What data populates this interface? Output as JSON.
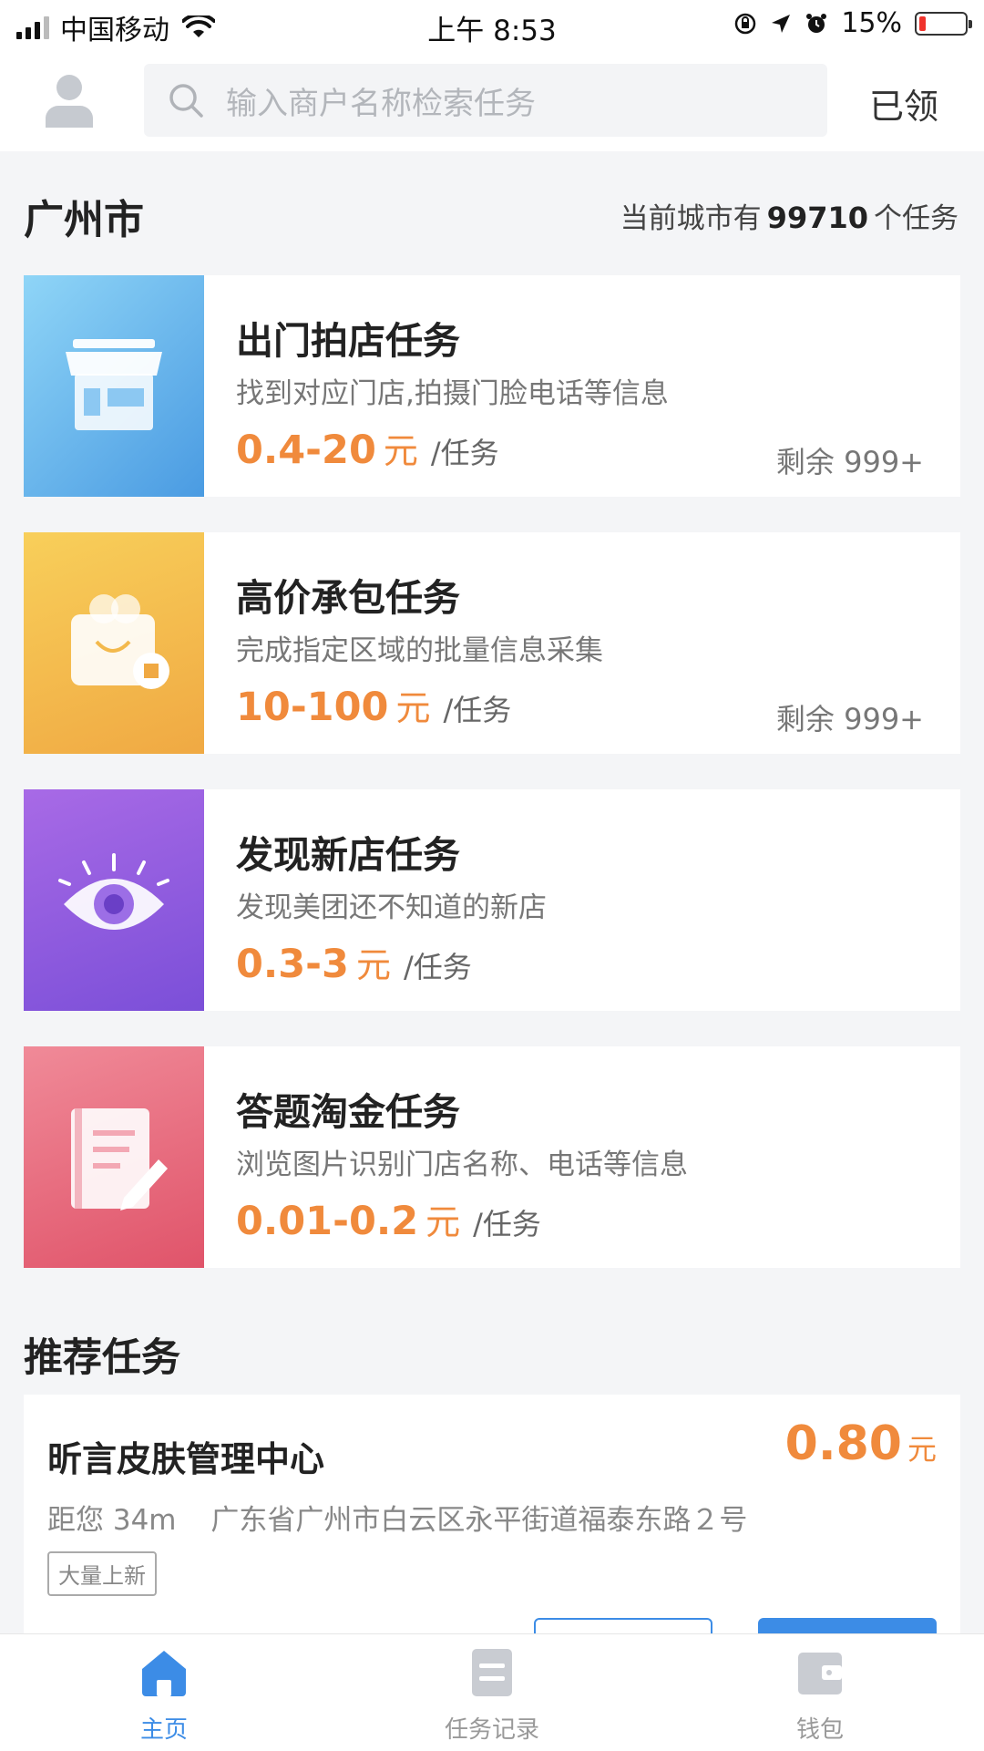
{
  "status_bar": {
    "carrier": "中国移动",
    "time": "上午 8:53",
    "battery": "15%"
  },
  "header": {
    "search_placeholder": "输入商户名称检索任务",
    "claimed_label": "已领"
  },
  "city": {
    "name": "广州市",
    "count_prefix": "当前城市有",
    "count_value": "99710",
    "count_suffix": "个任务"
  },
  "tasks": [
    {
      "title": "出门拍店任务",
      "desc": "找到对应门店,拍摄门脸电话等信息",
      "price": "0.4-20",
      "unit": "元",
      "per": "/任务",
      "remain": "剩余 999+",
      "colors": [
        "#8fd5f7",
        "#4a9be2"
      ],
      "icon": "store-icon"
    },
    {
      "title": "高价承包任务",
      "desc": "完成指定区域的批量信息采集",
      "price": "10-100",
      "unit": "元",
      "per": "/任务",
      "remain": "剩余 999+",
      "colors": [
        "#f8cf5a",
        "#f0a943"
      ],
      "icon": "shopping-bag-icon"
    },
    {
      "title": "发现新店任务",
      "desc": "发现美团还不知道的新店",
      "price": "0.3-3",
      "unit": "元",
      "per": "/任务",
      "remain": "",
      "colors": [
        "#a86ae6",
        "#7b4fd8"
      ],
      "icon": "eye-icon"
    },
    {
      "title": "答题淘金任务",
      "desc": "浏览图片识别门店名称、电话等信息",
      "price": "0.01-0.2",
      "unit": "元",
      "per": "/任务",
      "remain": "",
      "colors": [
        "#f08a98",
        "#e0546a"
      ],
      "icon": "document-edit-icon"
    }
  ],
  "recommend": {
    "section_title": "推荐任务",
    "name": "昕言皮肤管理中心",
    "price": "0.80",
    "price_unit": "元",
    "distance": "距您 34m",
    "address": "广东省广州市白云区永平街道福泰东路２号",
    "tag": "大量上新"
  },
  "tabbar": {
    "home": "主页",
    "records": "任务记录",
    "wallet": "钱包"
  },
  "colors": {
    "accent": "#3c8ce6",
    "price": "#f08a3c"
  }
}
